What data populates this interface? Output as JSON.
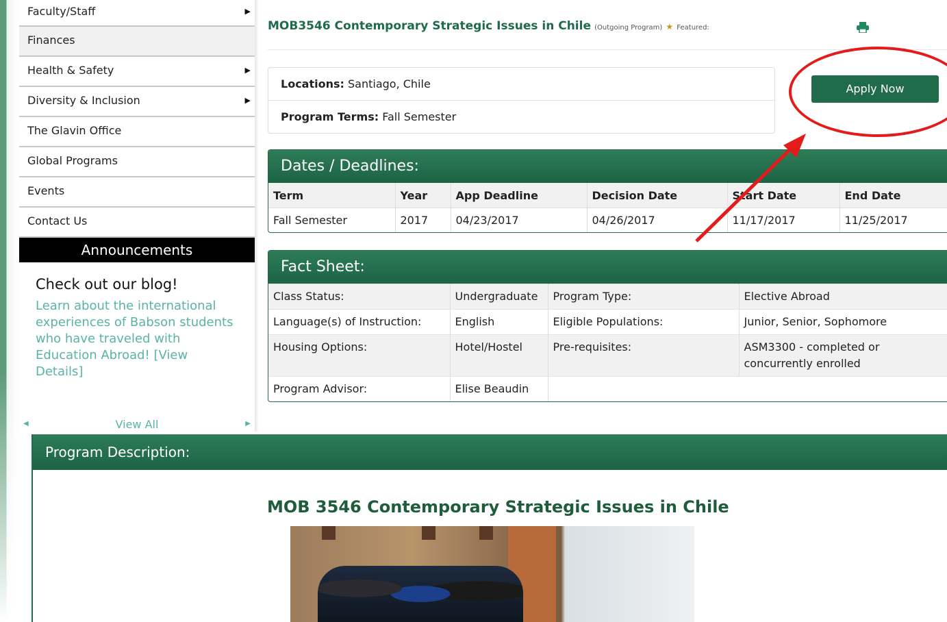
{
  "sidebar": {
    "items": [
      {
        "label": "Faculty/Staff",
        "submenu": true
      },
      {
        "label": "Finances",
        "submenu": false
      },
      {
        "label": "Health & Safety",
        "submenu": true
      },
      {
        "label": "Diversity & Inclusion",
        "submenu": true
      },
      {
        "label": "The Glavin Office",
        "submenu": false
      },
      {
        "label": "Global Programs",
        "submenu": false
      },
      {
        "label": "Events",
        "submenu": false
      },
      {
        "label": "Contact Us",
        "submenu": false
      }
    ],
    "announcements": {
      "heading": "Announcements",
      "title": "Check out our blog!",
      "text": "Learn about the international experiences of Babson students who have traveled with Education Abroad! [View Details]",
      "view_all": "View All"
    }
  },
  "program": {
    "title": "MOB3546 Contemporary Strategic Issues in Chile",
    "type_note": "(Outgoing Program)",
    "featured_label": "Featured:",
    "locations_label": "Locations:",
    "locations_value": "Santiago, Chile",
    "terms_label": "Program Terms:",
    "terms_value": "Fall Semester",
    "apply_label": "Apply Now"
  },
  "dates": {
    "heading": "Dates / Deadlines:",
    "columns": [
      "Term",
      "Year",
      "App Deadline",
      "Decision Date",
      "Start Date",
      "End Date"
    ],
    "rows": [
      [
        "Fall Semester",
        "2017",
        "04/23/2017",
        "04/26/2017",
        "11/17/2017",
        "11/25/2017"
      ]
    ]
  },
  "fact_sheet": {
    "heading": "Fact Sheet:",
    "rows": [
      [
        "Class Status:",
        "Undergraduate",
        "Program Type:",
        "Elective Abroad"
      ],
      [
        "Language(s) of Instruction:",
        "English",
        "Eligible Populations:",
        "Junior, Senior, Sophomore"
      ],
      [
        "Housing Options:",
        "Hotel/Hostel",
        "Pre-requisites:",
        "ASM3300 - completed or concurrently enrolled"
      ],
      [
        "Program Advisor:",
        "Elise Beaudin",
        "",
        ""
      ]
    ]
  },
  "description": {
    "heading": "Program Description:",
    "title": "MOB 3546 Contemporary Strategic Issues in Chile"
  },
  "colors": {
    "brand_green": "#1f6b4a",
    "annotation_red": "#e41b1b",
    "link_teal": "#5ab3a4"
  }
}
